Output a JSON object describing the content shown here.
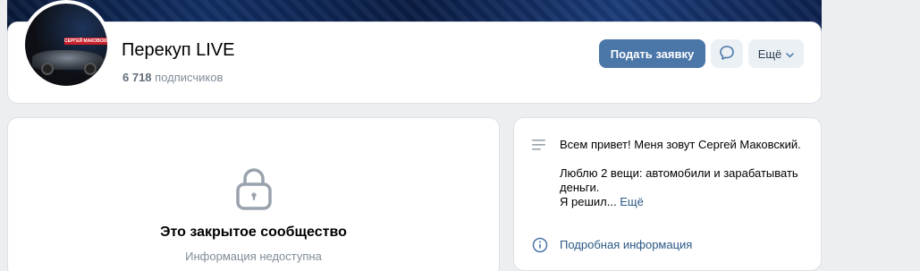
{
  "group": {
    "name": "Перекуп LIVE",
    "subscribers_count": "6 718",
    "subscribers_label": "подписчиков",
    "avatar_badge": "СЕРГЕЙ МАКОВСКИЙ"
  },
  "actions": {
    "apply_label": "Подать заявку",
    "more_label": "Ещё"
  },
  "closed": {
    "title": "Это закрытое сообщество",
    "subtitle": "Информация недоступна"
  },
  "about": {
    "line1": "Всем привет! Меня зовут Сергей Маковский.",
    "line2": "Люблю 2 вещи: автомобили и зарабатывать деньги.",
    "line3": "Я решил...",
    "more_link": "Ещё",
    "details_link": "Подробная информация"
  },
  "colors": {
    "accent": "#4a76a8",
    "link": "#2a5885",
    "muted": "#818c99",
    "background": "#edeef0"
  },
  "icons": [
    "message-icon",
    "chevron-down-icon",
    "lock-icon",
    "description-icon",
    "info-icon"
  ]
}
